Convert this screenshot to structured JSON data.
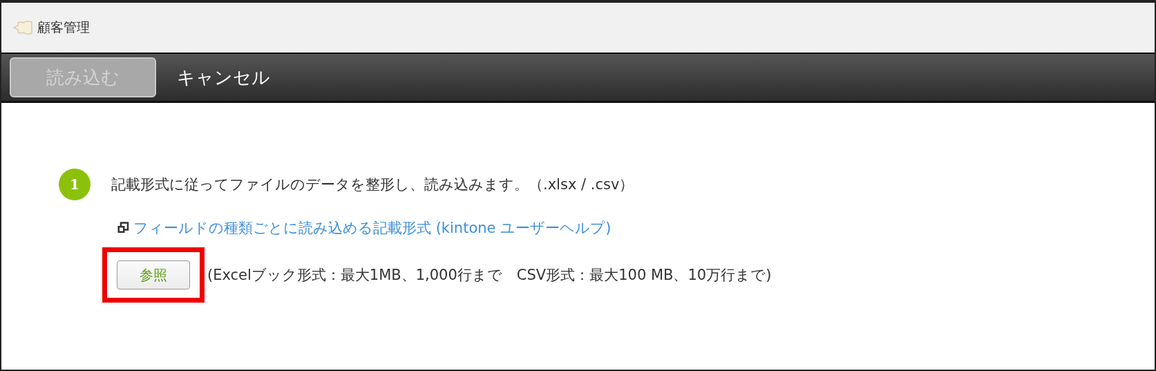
{
  "header": {
    "title": "顧客管理"
  },
  "toolbar": {
    "buttons": [
      {
        "kind": "primary",
        "label": "読み込む",
        "disabled": true
      },
      {
        "kind": "plain",
        "label": "キャンセル",
        "disabled": false
      }
    ]
  },
  "step": {
    "number": "1",
    "text": "記載形式に従ってファイルのデータを整形し、読み込みます。（.xlsx / .csv）",
    "link": "フィールドの種類ごとに読み込める記載形式 (kintone ユーザーヘルプ)"
  },
  "file_picker": {
    "button": "参照",
    "highlighted": true,
    "note": "(Excelブック形式：最大1MB、1,000行まで　CSV形式：最大100 MB、10万行まで)"
  }
}
